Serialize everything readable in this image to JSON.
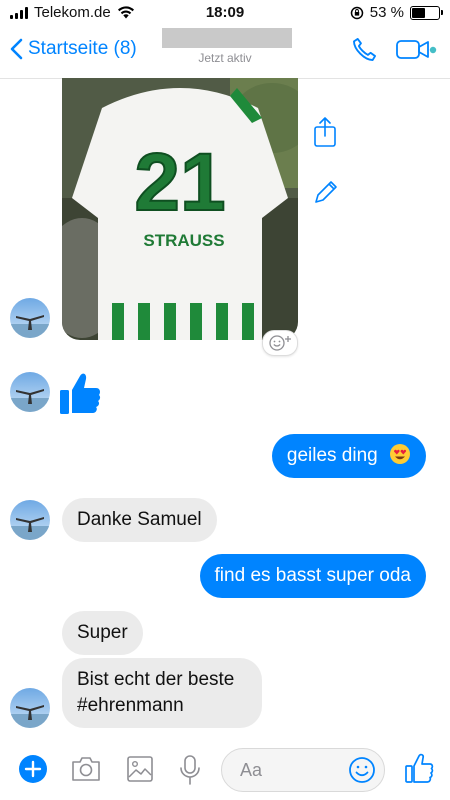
{
  "status_bar": {
    "carrier": "Telekom.de",
    "time": "18:09",
    "battery_text": "53 %",
    "battery_level": 0.53
  },
  "nav": {
    "back_label": "Startseite (8)",
    "presence": "Jetzt aktiv"
  },
  "photo": {
    "jersey_number": "21",
    "jersey_name": "STRAUSS"
  },
  "messages": [
    {
      "from": "me",
      "text": "geiles ding",
      "emoji": "heart-eyes-emoji"
    },
    {
      "from": "them",
      "text": "Danke Samuel"
    },
    {
      "from": "me",
      "text": "find es basst super oda"
    },
    {
      "from": "them",
      "text": "Super"
    },
    {
      "from": "them",
      "text": "Bist echt der beste #ehrenmann"
    }
  ],
  "composer": {
    "placeholder": "Aa"
  },
  "colors": {
    "accent": "#0084ff",
    "incoming_bubble": "#ebebeb",
    "online_dot": "#44bec7"
  }
}
